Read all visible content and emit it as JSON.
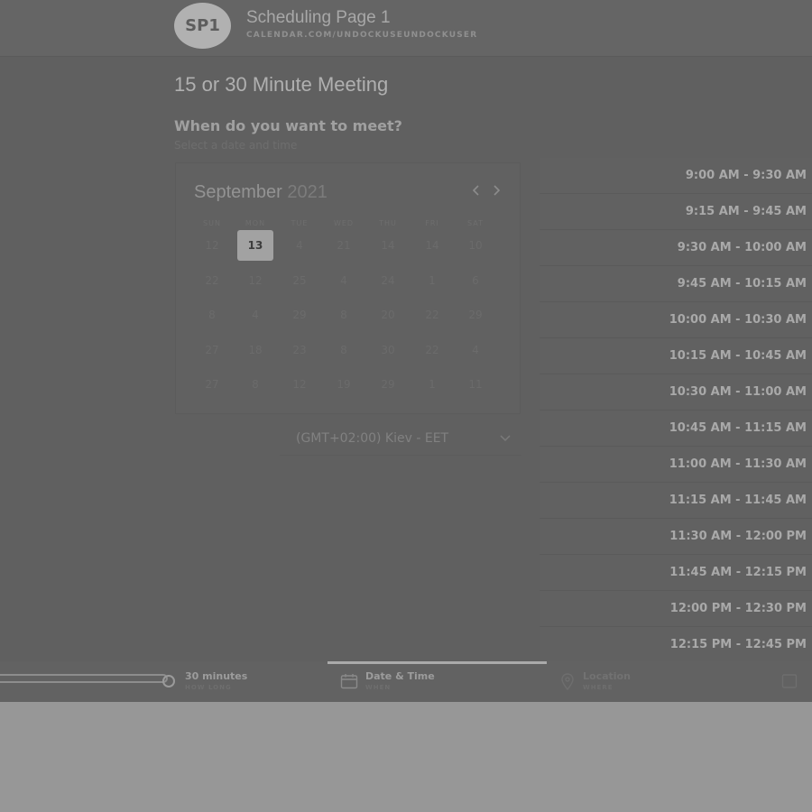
{
  "header": {
    "avatar_initials": "SP1",
    "title": "Scheduling Page 1",
    "url": "CALENDAR.COM/UNDOCKUSEUNDOCKUSER"
  },
  "meeting": {
    "title": "15 or 30 Minute Meeting",
    "question": "When do you want to meet?",
    "subtitle": "Select a date and time"
  },
  "calendar": {
    "month": "September",
    "year": "2021",
    "weekdays": [
      "SUN",
      "MON",
      "TUE",
      "WED",
      "THU",
      "FRI",
      "SAT"
    ],
    "rows": [
      [
        "12",
        "13",
        "4",
        "21",
        "14",
        "14",
        "10"
      ],
      [
        "22",
        "12",
        "25",
        "4",
        "24",
        "1",
        "6"
      ],
      [
        "8",
        "4",
        "29",
        "8",
        "20",
        "22",
        "29"
      ],
      [
        "27",
        "18",
        "23",
        "8",
        "30",
        "22",
        "4"
      ],
      [
        "27",
        "8",
        "12",
        "19",
        "29",
        "1",
        "11"
      ]
    ],
    "selected": "13"
  },
  "timezone": {
    "label": "(GMT+02:00) Kiev - EET"
  },
  "time_slots": [
    "9:00 AM - 9:30 AM",
    "9:15 AM - 9:45 AM",
    "9:30 AM - 10:00 AM",
    "9:45 AM - 10:15 AM",
    "10:00 AM - 10:30 AM",
    "10:15 AM - 10:45 AM",
    "10:30 AM - 11:00 AM",
    "10:45 AM - 11:15 AM",
    "11:00 AM - 11:30 AM",
    "11:15 AM - 11:45 AM",
    "11:30 AM - 12:00 PM",
    "11:45 AM - 12:15 PM",
    "12:00 PM - 12:30 PM",
    "12:15 PM - 12:45 PM"
  ],
  "footer": {
    "duration": {
      "label": "30 minutes",
      "sub": "HOW LONG"
    },
    "datetime": {
      "label": "Date & Time",
      "sub": "WHEN"
    },
    "location": {
      "label": "Location",
      "sub": "WHERE"
    }
  }
}
